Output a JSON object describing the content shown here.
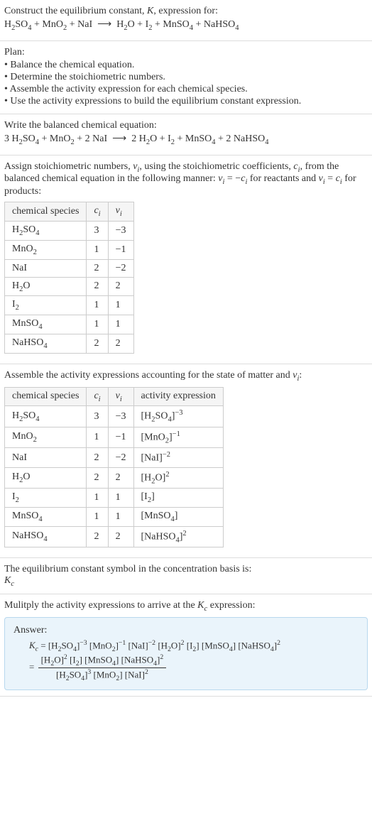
{
  "s1": {
    "line1": "Construct the equilibrium constant, <i>K</i>, expression for:",
    "eq": "H<sub>2</sub>SO<sub>4</sub> + MnO<sub>2</sub> + NaI &nbsp;&#10230;&nbsp; H<sub>2</sub>O + I<sub>2</sub> + MnSO<sub>4</sub> + NaHSO<sub>4</sub>"
  },
  "s2": {
    "title": "Plan:",
    "items": [
      "• Balance the chemical equation.",
      "• Determine the stoichiometric numbers.",
      "• Assemble the activity expression for each chemical species.",
      "• Use the activity expressions to build the equilibrium constant expression."
    ]
  },
  "s3": {
    "line1": "Write the balanced chemical equation:",
    "eq": "3 H<sub>2</sub>SO<sub>4</sub> + MnO<sub>2</sub> + 2 NaI &nbsp;&#10230;&nbsp; 2 H<sub>2</sub>O + I<sub>2</sub> + MnSO<sub>4</sub> + 2 NaHSO<sub>4</sub>"
  },
  "s4": {
    "intro": "Assign stoichiometric numbers, <i>&nu;<sub>i</sub></i>, using the stoichiometric coefficients, <i>c<sub>i</sub></i>, from the balanced chemical equation in the following manner: <i>&nu;<sub>i</sub></i> = &minus;<i>c<sub>i</sub></i> for reactants and <i>&nu;<sub>i</sub></i> = <i>c<sub>i</sub></i> for products:",
    "headers": [
      "chemical species",
      "<i>c<sub>i</sub></i>",
      "<i>&nu;<sub>i</sub></i>"
    ],
    "rows": [
      [
        "H<sub>2</sub>SO<sub>4</sub>",
        "3",
        "&minus;3"
      ],
      [
        "MnO<sub>2</sub>",
        "1",
        "&minus;1"
      ],
      [
        "NaI",
        "2",
        "&minus;2"
      ],
      [
        "H<sub>2</sub>O",
        "2",
        "2"
      ],
      [
        "I<sub>2</sub>",
        "1",
        "1"
      ],
      [
        "MnSO<sub>4</sub>",
        "1",
        "1"
      ],
      [
        "NaHSO<sub>4</sub>",
        "2",
        "2"
      ]
    ]
  },
  "s5": {
    "intro": "Assemble the activity expressions accounting for the state of matter and <i>&nu;<sub>i</sub></i>:",
    "headers": [
      "chemical species",
      "<i>c<sub>i</sub></i>",
      "<i>&nu;<sub>i</sub></i>",
      "activity expression"
    ],
    "rows": [
      [
        "H<sub>2</sub>SO<sub>4</sub>",
        "3",
        "&minus;3",
        "[H<sub>2</sub>SO<sub>4</sub>]<sup>&minus;3</sup>"
      ],
      [
        "MnO<sub>2</sub>",
        "1",
        "&minus;1",
        "[MnO<sub>2</sub>]<sup>&minus;1</sup>"
      ],
      [
        "NaI",
        "2",
        "&minus;2",
        "[NaI]<sup>&minus;2</sup>"
      ],
      [
        "H<sub>2</sub>O",
        "2",
        "2",
        "[H<sub>2</sub>O]<sup>2</sup>"
      ],
      [
        "I<sub>2</sub>",
        "1",
        "1",
        "[I<sub>2</sub>]"
      ],
      [
        "MnSO<sub>4</sub>",
        "1",
        "1",
        "[MnSO<sub>4</sub>]"
      ],
      [
        "NaHSO<sub>4</sub>",
        "2",
        "2",
        "[NaHSO<sub>4</sub>]<sup>2</sup>"
      ]
    ]
  },
  "s6": {
    "line1": "The equilibrium constant symbol in the concentration basis is:",
    "sym": "<i>K<sub>c</sub></i>"
  },
  "s7": {
    "line1": "Mulitply the activity expressions to arrive at the <i>K<sub>c</sub></i> expression:",
    "answer_label": "Answer:",
    "kc_flat": "<i>K<sub>c</sub></i> = [H<sub>2</sub>SO<sub>4</sub>]<sup>&minus;3</sup> [MnO<sub>2</sub>]<sup>&minus;1</sup> [NaI]<sup>&minus;2</sup> [H<sub>2</sub>O]<sup>2</sup> [I<sub>2</sub>] [MnSO<sub>4</sub>] [NaHSO<sub>4</sub>]<sup>2</sup>",
    "frac_num": "[H<sub>2</sub>O]<sup>2</sup> [I<sub>2</sub>] [MnSO<sub>4</sub>] [NaHSO<sub>4</sub>]<sup>2</sup>",
    "frac_den": "[H<sub>2</sub>SO<sub>4</sub>]<sup>3</sup> [MnO<sub>2</sub>] [NaI]<sup>2</sup>"
  }
}
